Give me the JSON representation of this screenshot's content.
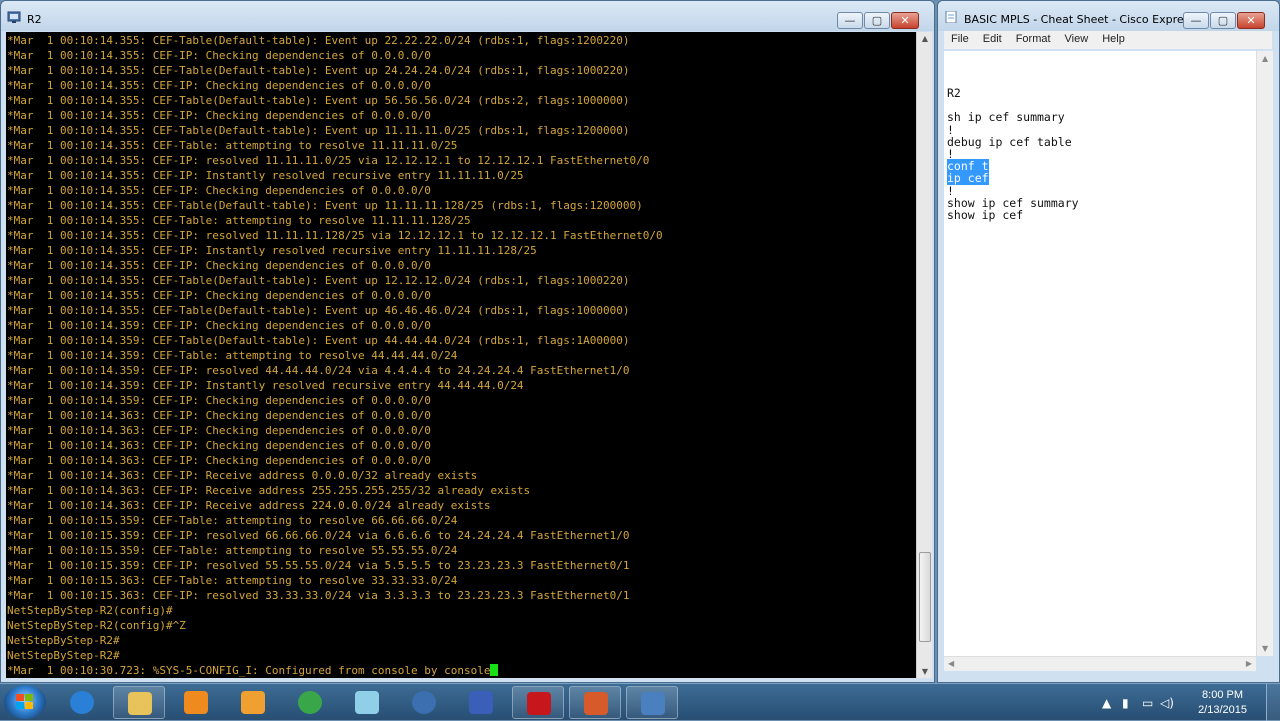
{
  "terminal": {
    "title": "R2",
    "lines": [
      "*Mar  1 00:10:14.355: CEF-Table(Default-table): Event up 22.22.22.0/24 (rdbs:1, flags:1200220)",
      "*Mar  1 00:10:14.355: CEF-IP: Checking dependencies of 0.0.0.0/0",
      "*Mar  1 00:10:14.355: CEF-Table(Default-table): Event up 24.24.24.0/24 (rdbs:1, flags:1000220)",
      "*Mar  1 00:10:14.355: CEF-IP: Checking dependencies of 0.0.0.0/0",
      "*Mar  1 00:10:14.355: CEF-Table(Default-table): Event up 56.56.56.0/24 (rdbs:2, flags:1000000)",
      "*Mar  1 00:10:14.355: CEF-IP: Checking dependencies of 0.0.0.0/0",
      "*Mar  1 00:10:14.355: CEF-Table(Default-table): Event up 11.11.11.0/25 (rdbs:1, flags:1200000)",
      "*Mar  1 00:10:14.355: CEF-Table: attempting to resolve 11.11.11.0/25",
      "*Mar  1 00:10:14.355: CEF-IP: resolved 11.11.11.0/25 via 12.12.12.1 to 12.12.12.1 FastEthernet0/0",
      "*Mar  1 00:10:14.355: CEF-IP: Instantly resolved recursive entry 11.11.11.0/25",
      "*Mar  1 00:10:14.355: CEF-IP: Checking dependencies of 0.0.0.0/0",
      "*Mar  1 00:10:14.355: CEF-Table(Default-table): Event up 11.11.11.128/25 (rdbs:1, flags:1200000)",
      "*Mar  1 00:10:14.355: CEF-Table: attempting to resolve 11.11.11.128/25",
      "*Mar  1 00:10:14.355: CEF-IP: resolved 11.11.11.128/25 via 12.12.12.1 to 12.12.12.1 FastEthernet0/0",
      "*Mar  1 00:10:14.355: CEF-IP: Instantly resolved recursive entry 11.11.11.128/25",
      "*Mar  1 00:10:14.355: CEF-IP: Checking dependencies of 0.0.0.0/0",
      "*Mar  1 00:10:14.355: CEF-Table(Default-table): Event up 12.12.12.0/24 (rdbs:1, flags:1000220)",
      "*Mar  1 00:10:14.355: CEF-IP: Checking dependencies of 0.0.0.0/0",
      "*Mar  1 00:10:14.355: CEF-Table(Default-table): Event up 46.46.46.0/24 (rdbs:1, flags:1000000)",
      "*Mar  1 00:10:14.359: CEF-IP: Checking dependencies of 0.0.0.0/0",
      "*Mar  1 00:10:14.359: CEF-Table(Default-table): Event up 44.44.44.0/24 (rdbs:1, flags:1A00000)",
      "*Mar  1 00:10:14.359: CEF-Table: attempting to resolve 44.44.44.0/24",
      "*Mar  1 00:10:14.359: CEF-IP: resolved 44.44.44.0/24 via 4.4.4.4 to 24.24.24.4 FastEthernet1/0",
      "*Mar  1 00:10:14.359: CEF-IP: Instantly resolved recursive entry 44.44.44.0/24",
      "*Mar  1 00:10:14.359: CEF-IP: Checking dependencies of 0.0.0.0/0",
      "*Mar  1 00:10:14.363: CEF-IP: Checking dependencies of 0.0.0.0/0",
      "*Mar  1 00:10:14.363: CEF-IP: Checking dependencies of 0.0.0.0/0",
      "*Mar  1 00:10:14.363: CEF-IP: Checking dependencies of 0.0.0.0/0",
      "*Mar  1 00:10:14.363: CEF-IP: Checking dependencies of 0.0.0.0/0",
      "*Mar  1 00:10:14.363: CEF-IP: Receive address 0.0.0.0/32 already exists",
      "*Mar  1 00:10:14.363: CEF-IP: Receive address 255.255.255.255/32 already exists",
      "*Mar  1 00:10:14.363: CEF-IP: Receive address 224.0.0.0/24 already exists",
      "*Mar  1 00:10:15.359: CEF-Table: attempting to resolve 66.66.66.0/24",
      "*Mar  1 00:10:15.359: CEF-IP: resolved 66.66.66.0/24 via 6.6.6.6 to 24.24.24.4 FastEthernet1/0",
      "*Mar  1 00:10:15.359: CEF-Table: attempting to resolve 55.55.55.0/24",
      "*Mar  1 00:10:15.359: CEF-IP: resolved 55.55.55.0/24 via 5.5.5.5 to 23.23.23.3 FastEthernet0/1",
      "*Mar  1 00:10:15.363: CEF-Table: attempting to resolve 33.33.33.0/24",
      "*Mar  1 00:10:15.363: CEF-IP: resolved 33.33.33.0/24 via 3.3.3.3 to 23.23.23.3 FastEthernet0/1",
      "NetStepByStep-R2(config)#",
      "NetStepByStep-R2(config)#^Z",
      "NetStepByStep-R2#",
      "NetStepByStep-R2#",
      "*Mar  1 00:10:30.723: %SYS-5-CONFIG_I: Configured from console by console"
    ]
  },
  "notepad": {
    "title": "BASIC MPLS - Cheat Sheet - Cisco Expres...",
    "menu": [
      "File",
      "Edit",
      "Format",
      "View",
      "Help"
    ],
    "lines": [
      {
        "text": "R2",
        "selected": false
      },
      {
        "text": "",
        "selected": false
      },
      {
        "text": "sh ip cef summary",
        "selected": false
      },
      {
        "text": "!",
        "selected": false
      },
      {
        "text": "debug ip cef table",
        "selected": false
      },
      {
        "text": "!",
        "selected": false
      },
      {
        "text": "conf t",
        "selected": true
      },
      {
        "text": "ip cef",
        "selected": true
      },
      {
        "text": "!",
        "selected": false
      },
      {
        "text": "show ip cef summary",
        "selected": false
      },
      {
        "text": "show ip cef",
        "selected": false
      }
    ]
  },
  "window_buttons": {
    "minimize": "—",
    "maximize": "▢",
    "close": "✕"
  },
  "taskbar": {
    "time": "8:00 PM",
    "date": "2/13/2015",
    "apps": [
      {
        "name": "internet-explorer",
        "color": "#2a7fd6"
      },
      {
        "name": "file-explorer",
        "color": "#e8c25a"
      },
      {
        "name": "media-player",
        "color": "#ef8a1e"
      },
      {
        "name": "outlook",
        "color": "#f0a030"
      },
      {
        "name": "chrome",
        "color": "#3aa64a"
      },
      {
        "name": "notepad",
        "color": "#8fd0e8"
      },
      {
        "name": "network-app",
        "color": "#3b6fb0"
      },
      {
        "name": "visio",
        "color": "#3a5fb8"
      },
      {
        "name": "acrobat",
        "color": "#c8171c"
      },
      {
        "name": "powerpoint",
        "color": "#d65a2a"
      },
      {
        "name": "terminal-app",
        "color": "#4a7fc0"
      }
    ]
  }
}
